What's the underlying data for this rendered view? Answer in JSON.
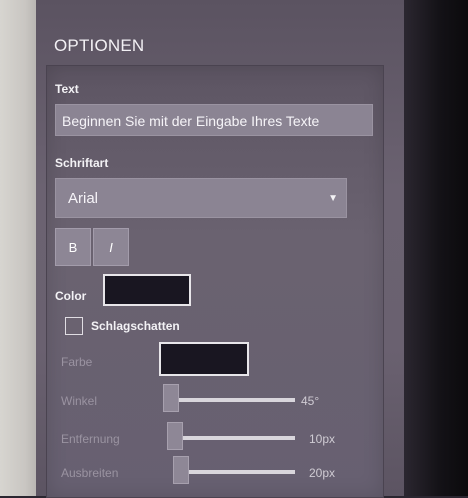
{
  "panel": {
    "title": "OPTIONEN",
    "text_label": "Text",
    "text_value": "Beginnen Sie mit der Eingabe Ihres Texte",
    "font_label": "Schriftart",
    "font_value": "Arial",
    "bold_label": "B",
    "italic_label": "I",
    "color_label": "Color",
    "color_value": "#191621",
    "shadow_checkbox_label": "Schlagschatten",
    "shadow_checked": false,
    "shadow": {
      "color_label": "Farbe",
      "color_value": "#191621",
      "angle_label": "Winkel",
      "angle_value": "45°",
      "distance_label": "Entfernung",
      "distance_value": "10px",
      "spread_label": "Ausbreiten",
      "spread_value": "20px"
    }
  },
  "icons": {
    "dropdown": "chevron-down-icon"
  }
}
